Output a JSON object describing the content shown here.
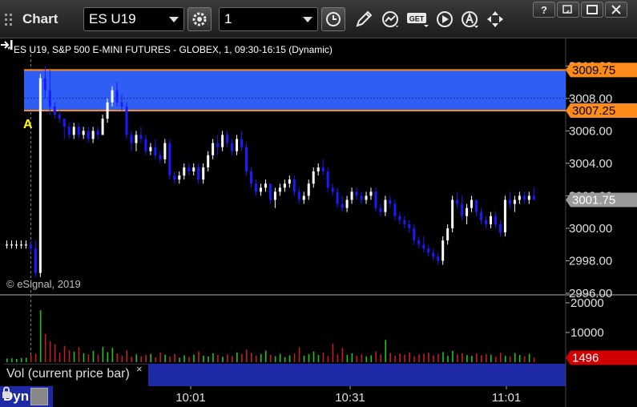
{
  "toolbar": {
    "title": "Chart",
    "symbol": "ES U19",
    "interval": "1",
    "icons": [
      "gear-icon",
      "clock-icon",
      "pencil-icon",
      "study-icon",
      "get-icon",
      "play-icon",
      "alert-icon",
      "move-icon"
    ],
    "window_icons": [
      "help-icon",
      "restore-icon",
      "maximize-icon",
      "close-icon"
    ]
  },
  "chart_header": "* ES U19, S&P 500 E-MINI FUTURES - GLOBEX, 1, 09:30-16:15 (Dynamic)",
  "watermark": "© eSignal, 2019",
  "volume_legend": "Vol (current price bar)",
  "volume_close": "×",
  "dyn_label": "Dyn",
  "colors": {
    "up": "#ffffff",
    "down": "#1a1aff",
    "zone_fill": "#2f5ef5",
    "zone_line": "#ff8c1a",
    "vol_up": "#1fc41f",
    "vol_down": "#c41f1f",
    "axis_bg": "#000000",
    "last_price_bg": "#9a9a9a",
    "last_volume_bg": "#d10000"
  },
  "chart_data": [
    {
      "type": "candlestick",
      "price_axis_ticks": [
        "3010.00",
        "3008.00",
        "3006.00",
        "3004.00",
        "3002.00",
        "3000.00",
        "2998.00",
        "2996.00"
      ],
      "ylim": [
        2996.0,
        3011.0
      ],
      "zone": {
        "low": 3007.25,
        "high": 3009.75,
        "low_label": "3007.25",
        "high_label": "3009.75"
      },
      "last_price": 3001.75,
      "last_price_label": "3001.75",
      "annotation": "A",
      "candles": [
        [
          2999.0,
          2999.25,
          2998.75,
          2999.0
        ],
        [
          2999.0,
          2999.25,
          2998.75,
          2999.0
        ],
        [
          2999.0,
          2999.25,
          2998.75,
          2999.0
        ],
        [
          2999.0,
          2999.25,
          2998.75,
          2999.0
        ],
        [
          2999.0,
          2999.25,
          2998.75,
          2999.0
        ],
        [
          2999.0,
          2999.25,
          2998.5,
          2998.75
        ],
        [
          2998.75,
          2999.25,
          2997.0,
          2997.25
        ],
        [
          2997.25,
          3009.5,
          2997.0,
          3009.25
        ],
        [
          3009.25,
          3010.0,
          3008.0,
          3008.5
        ],
        [
          3008.5,
          3009.75,
          3007.0,
          3007.5
        ],
        [
          3007.5,
          3007.75,
          3006.75,
          3007.0
        ],
        [
          3007.0,
          3007.25,
          3006.5,
          3006.75
        ],
        [
          3006.75,
          3006.75,
          3005.5,
          3006.25
        ],
        [
          3006.25,
          3006.5,
          3005.5,
          3005.75
        ],
        [
          3005.75,
          3006.5,
          3005.5,
          3006.25
        ],
        [
          3006.25,
          3006.5,
          3005.5,
          3005.75
        ],
        [
          3005.75,
          3006.25,
          3005.5,
          3006.0
        ],
        [
          3006.0,
          3006.25,
          3005.25,
          3005.5
        ],
        [
          3005.5,
          3006.25,
          3005.25,
          3006.0
        ],
        [
          3006.0,
          3006.25,
          3005.5,
          3005.75
        ],
        [
          3005.75,
          3007.0,
          3005.75,
          3006.75
        ],
        [
          3006.75,
          3008.0,
          3006.5,
          3007.75
        ],
        [
          3007.75,
          3008.75,
          3007.5,
          3008.5
        ],
        [
          3008.5,
          3009.0,
          3007.5,
          3007.75
        ],
        [
          3007.75,
          3008.25,
          3007.25,
          3007.5
        ],
        [
          3007.5,
          3007.75,
          3005.5,
          3005.75
        ],
        [
          3005.75,
          3006.0,
          3004.75,
          3005.25
        ],
        [
          3005.25,
          3006.0,
          3004.75,
          3005.75
        ],
        [
          3005.75,
          3006.25,
          3005.25,
          3005.5
        ],
        [
          3005.5,
          3005.75,
          3004.5,
          3004.75
        ],
        [
          3004.75,
          3005.25,
          3004.5,
          3005.0
        ],
        [
          3005.0,
          3005.5,
          3004.25,
          3004.5
        ],
        [
          3004.5,
          3004.75,
          3004.0,
          3004.25
        ],
        [
          3004.25,
          3005.5,
          3004.0,
          3005.25
        ],
        [
          3005.25,
          3005.5,
          3003.0,
          3003.25
        ],
        [
          3003.25,
          3003.5,
          3002.75,
          3003.0
        ],
        [
          3003.0,
          3003.5,
          3002.75,
          3003.25
        ],
        [
          3003.25,
          3004.0,
          3003.0,
          3003.75
        ],
        [
          3003.75,
          3004.0,
          3003.25,
          3003.5
        ],
        [
          3003.5,
          3004.0,
          3003.25,
          3003.75
        ],
        [
          3003.75,
          3004.0,
          3002.75,
          3003.0
        ],
        [
          3003.0,
          3004.0,
          3002.75,
          3003.75
        ],
        [
          3003.75,
          3004.75,
          3003.5,
          3004.5
        ],
        [
          3004.5,
          3005.5,
          3004.25,
          3005.25
        ],
        [
          3005.25,
          3005.75,
          3004.5,
          3005.0
        ],
        [
          3005.0,
          3006.0,
          3004.75,
          3005.75
        ],
        [
          3005.75,
          3006.0,
          3005.0,
          3005.25
        ],
        [
          3005.25,
          3005.5,
          3004.5,
          3004.75
        ],
        [
          3004.75,
          3005.75,
          3004.5,
          3005.5
        ],
        [
          3005.5,
          3006.0,
          3004.75,
          3005.0
        ],
        [
          3005.0,
          3005.25,
          3003.25,
          3003.5
        ],
        [
          3003.5,
          3003.75,
          3002.5,
          3002.75
        ],
        [
          3002.75,
          3003.0,
          3002.0,
          3002.25
        ],
        [
          3002.25,
          3002.75,
          3002.0,
          3002.5
        ],
        [
          3002.5,
          3003.0,
          3002.25,
          3002.75
        ],
        [
          3002.75,
          3002.75,
          3001.5,
          3001.75
        ],
        [
          3001.75,
          3002.5,
          3001.25,
          3002.25
        ],
        [
          3002.25,
          3002.75,
          3002.0,
          3002.5
        ],
        [
          3002.5,
          3003.0,
          3002.25,
          3002.75
        ],
        [
          3002.75,
          3003.25,
          3002.5,
          3003.0
        ],
        [
          3003.0,
          3003.25,
          3002.0,
          3002.25
        ],
        [
          3002.25,
          3002.5,
          3001.5,
          3001.75
        ],
        [
          3001.75,
          3002.25,
          3001.5,
          3002.0
        ],
        [
          3002.0,
          3003.0,
          3001.75,
          3002.75
        ],
        [
          3002.75,
          3003.75,
          3002.5,
          3003.5
        ],
        [
          3003.5,
          3004.0,
          3003.25,
          3003.75
        ],
        [
          3003.75,
          3004.25,
          3003.25,
          3003.5
        ],
        [
          3003.5,
          3003.75,
          3002.25,
          3002.5
        ],
        [
          3002.5,
          3002.75,
          3002.0,
          3002.25
        ],
        [
          3002.25,
          3002.5,
          3001.25,
          3001.5
        ],
        [
          3001.5,
          3002.0,
          3001.0,
          3001.25
        ],
        [
          3001.25,
          3002.0,
          3001.0,
          3001.75
        ],
        [
          3001.75,
          3002.5,
          3001.5,
          3002.25
        ],
        [
          3002.25,
          3002.5,
          3001.75,
          3002.0
        ],
        [
          3002.0,
          3002.25,
          3001.5,
          3001.75
        ],
        [
          3001.75,
          3002.25,
          3001.5,
          3002.0
        ],
        [
          3002.0,
          3002.5,
          3001.75,
          3002.25
        ],
        [
          3002.25,
          3002.5,
          3001.0,
          3001.25
        ],
        [
          3001.25,
          3001.5,
          3000.75,
          3001.0
        ],
        [
          3001.0,
          3002.0,
          3000.75,
          3001.75
        ],
        [
          3001.75,
          3002.0,
          3001.25,
          3001.5
        ],
        [
          3001.5,
          3001.75,
          3000.5,
          3000.75
        ],
        [
          3000.75,
          3001.0,
          3000.25,
          3000.5
        ],
        [
          3000.5,
          3000.75,
          3000.0,
          3000.25
        ],
        [
          3000.25,
          3000.5,
          2999.75,
          3000.0
        ],
        [
          3000.0,
          3000.25,
          2999.0,
          2999.25
        ],
        [
          2999.25,
          2999.5,
          2998.75,
          2999.0
        ],
        [
          2999.0,
          2999.5,
          2998.5,
          2998.75
        ],
        [
          2998.75,
          2999.0,
          2998.25,
          2998.5
        ],
        [
          2998.5,
          2998.75,
          2998.0,
          2998.25
        ],
        [
          2998.25,
          2998.5,
          2997.75,
          2998.0
        ],
        [
          2998.0,
          2999.5,
          2997.75,
          2999.25
        ],
        [
          2999.25,
          3000.25,
          2999.0,
          3000.0
        ],
        [
          3000.0,
          3002.0,
          2999.75,
          3001.75
        ],
        [
          3001.75,
          3002.25,
          3001.25,
          3001.5
        ],
        [
          3001.5,
          3002.0,
          3000.5,
          3000.75
        ],
        [
          3000.75,
          3001.5,
          3000.25,
          3001.25
        ],
        [
          3001.25,
          3002.0,
          3001.0,
          3001.75
        ],
        [
          3001.75,
          3001.75,
          3000.75,
          3001.0
        ],
        [
          3001.0,
          3001.25,
          3000.25,
          3000.5
        ],
        [
          3000.5,
          3000.75,
          3000.0,
          3000.25
        ],
        [
          3000.25,
          3001.0,
          3000.0,
          3000.75
        ],
        [
          3000.75,
          3001.0,
          3000.0,
          3000.25
        ],
        [
          3000.25,
          3000.5,
          2999.5,
          2999.75
        ],
        [
          2999.75,
          3002.0,
          2999.5,
          3001.75
        ],
        [
          3001.75,
          3002.25,
          3001.25,
          3001.5
        ],
        [
          3001.5,
          3002.0,
          3001.0,
          3001.75
        ],
        [
          3001.75,
          3002.25,
          3001.5,
          3002.0
        ],
        [
          3002.0,
          3002.25,
          3001.5,
          3001.75
        ],
        [
          3001.75,
          3002.25,
          3001.5,
          3002.0
        ],
        [
          3002.0,
          3002.5,
          3001.75,
          3001.75
        ]
      ],
      "volume_axis_ticks": [
        "20000",
        "10000"
      ],
      "volume_ylim": [
        0,
        20000
      ],
      "last_volume": 1496,
      "last_volume_label": "1496",
      "volume": [
        1200,
        1300,
        1100,
        1400,
        1500,
        2400,
        2800,
        17500,
        9500,
        7000,
        6000,
        3200,
        5500,
        4000,
        3500,
        5000,
        3000,
        2600,
        3800,
        2500,
        5200,
        3400,
        4800,
        3000,
        2200,
        4000,
        1800,
        2600,
        2000,
        2400,
        2800,
        1600,
        3200,
        2500,
        1900,
        2700,
        1500,
        2300,
        1700,
        2500,
        3600,
        2200,
        1900,
        3000,
        2400,
        1800,
        2600,
        2000,
        3300,
        2800,
        4200,
        3100,
        2200,
        2700,
        3900,
        2500,
        2000,
        2800,
        1700,
        2300,
        2900,
        5000,
        2200,
        2700,
        3600,
        2400,
        3300,
        2100,
        6200,
        2600,
        4800,
        2400,
        3000,
        2100,
        2600,
        1900,
        2300,
        3500,
        2600,
        7500,
        3100,
        2200,
        2900,
        2500,
        3300,
        2000,
        2600,
        2800,
        3200,
        2300,
        2700,
        3400,
        2100,
        3800,
        2600,
        3000,
        2400,
        2100,
        2900,
        2300,
        2700,
        2500,
        1800,
        3200,
        2100,
        1900,
        3100,
        2400,
        2000,
        2800,
        1496
      ],
      "time_axis_ticks": [
        "10:01",
        "10:31",
        "11:01"
      ]
    }
  ]
}
